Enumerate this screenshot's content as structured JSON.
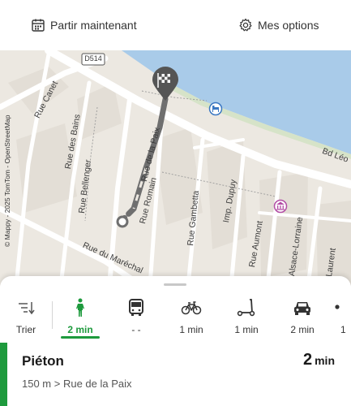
{
  "header": {
    "leave_now": {
      "label": "Partir maintenant",
      "icon": "calendar-icon"
    },
    "my_options": {
      "label": "Mes options",
      "icon": "gear-icon"
    }
  },
  "map": {
    "attribution": "© Mappy - 2025 TomTom - OpenStreetMap",
    "road_badge": "D514",
    "streets": {
      "rue_canet": "Rue Canet",
      "rue_des_bains": "Rue des Bains",
      "rue_bellenger": "Rue Bellenger",
      "rue_de_la_paix": "Rue de la Paix",
      "rue_romain": "Rue Romain",
      "rue_gambetta": "Rue Gambetta",
      "imp_dupuy": "Imp. Dupuy",
      "rue_aumont": "Rue Aumont",
      "rue_alsace_lorraine": "d'Alsace-Lorraine",
      "rue_laurent": "Laurent",
      "bd_leo": "Bd Léo",
      "rue_du_marechal": "Rue du Maréchal"
    },
    "colors": {
      "water": "#a9cbe9",
      "land": "#ece8e1",
      "road": "#ffffff",
      "route": "#6f6f6f"
    }
  },
  "transport_modes": {
    "sort": {
      "label": "Trier",
      "icon": "sort-icon"
    },
    "items": [
      {
        "id": "walk",
        "icon": "walking-person-icon",
        "duration": "2 min",
        "active": true
      },
      {
        "id": "bus",
        "icon": "bus-icon",
        "duration": "- -",
        "active": false
      },
      {
        "id": "bike",
        "icon": "bicycle-icon",
        "duration": "1 min",
        "active": false
      },
      {
        "id": "scooter",
        "icon": "kick-scooter-icon",
        "duration": "1 min",
        "active": false
      },
      {
        "id": "car",
        "icon": "car-icon",
        "duration": "2 min",
        "active": false
      },
      {
        "id": "more",
        "icon": "more-mode-icon",
        "duration": "1",
        "active": false
      }
    ]
  },
  "route": {
    "mode_name": "Piéton",
    "duration_value": "2",
    "duration_unit": "min",
    "detail": "150 m > Rue de la Paix",
    "accent_color": "#1e9a3d"
  }
}
